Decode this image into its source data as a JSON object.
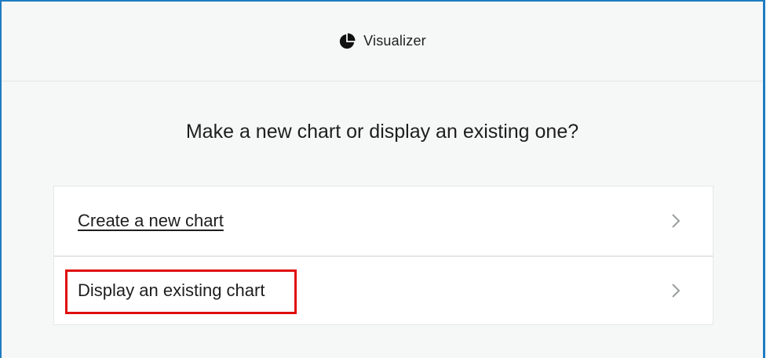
{
  "header": {
    "icon": "pie-chart-icon",
    "title": "Visualizer"
  },
  "main": {
    "question": "Make a new chart or display an existing one?",
    "options": [
      {
        "label": "Create a new chart",
        "icon": "chevron-right-icon"
      },
      {
        "label": "Display an existing chart",
        "icon": "chevron-right-icon",
        "highlighted": true
      }
    ]
  },
  "colors": {
    "frame_border": "#1f7cc1",
    "background": "#f6f8f7",
    "highlight": "#e00d0d"
  }
}
